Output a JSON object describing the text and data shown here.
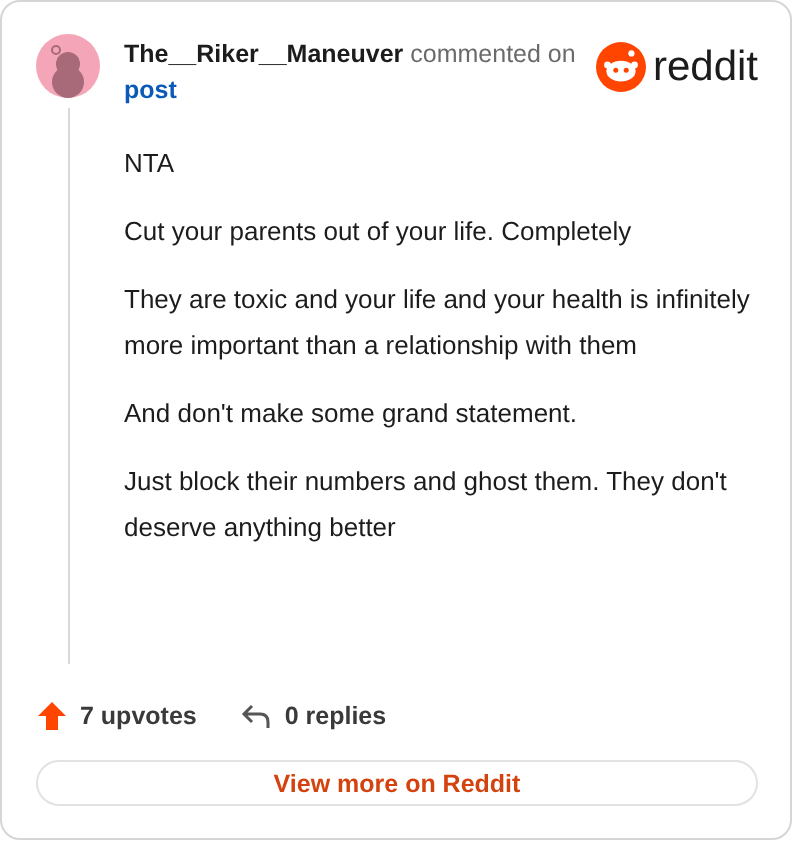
{
  "comment": {
    "author": "The__Riker__Maneuver",
    "action": "commented on",
    "target": "post",
    "paragraphs": [
      "NTA",
      "Cut your parents out of your life. Completely",
      "They are toxic and your life and your health is infinitely more important than a relationship with them",
      "And don't make some grand statement.",
      "Just block their numbers and ghost them. They don't deserve anything better"
    ]
  },
  "brand": "reddit",
  "stats": {
    "upvotes": "7 upvotes",
    "replies": "0 replies"
  },
  "button": "View more on Reddit"
}
